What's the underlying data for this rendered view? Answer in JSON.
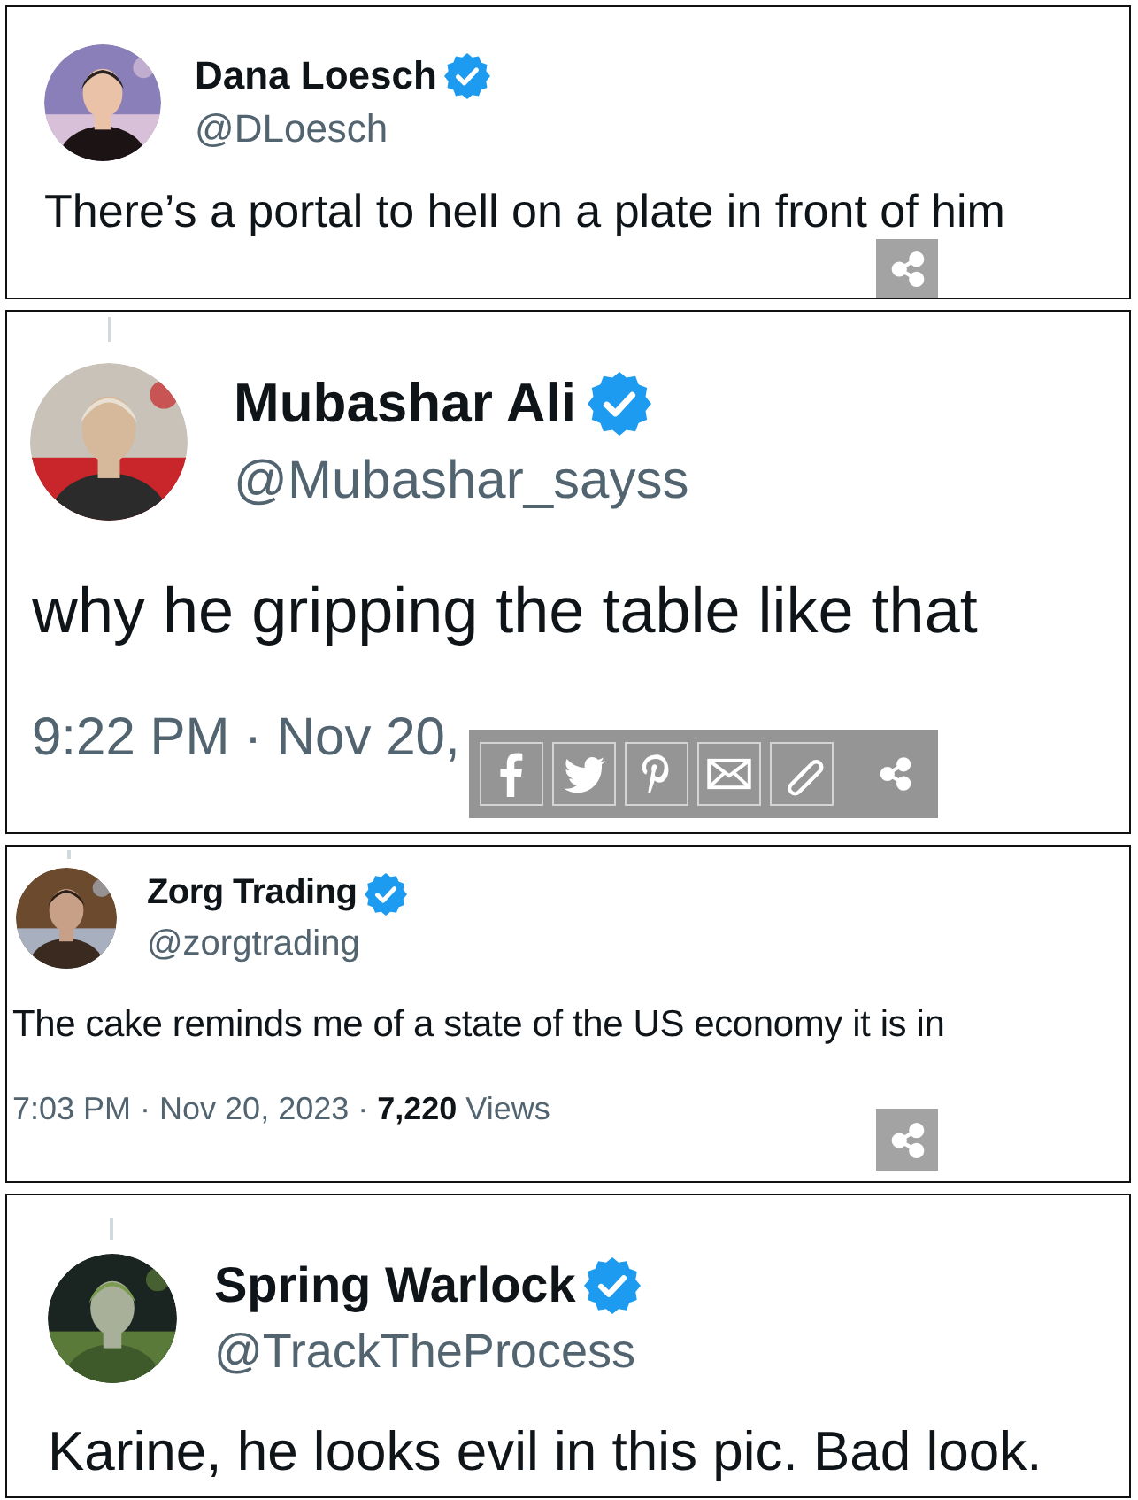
{
  "tweets": [
    {
      "name": "Dana Loesch",
      "verified": true,
      "handle": "@DLoesch",
      "thread_line": false,
      "text": "There’s a portal to hell on a plate in front of him",
      "share": {
        "kind": "button"
      }
    },
    {
      "name": "Mubashar Ali",
      "verified": true,
      "handle": "@Mubashar_sayss",
      "thread_line": true,
      "text": "why he gripping the table like that",
      "footer": "9:22 PM · Nov 20,",
      "share": {
        "kind": "toolbar"
      }
    },
    {
      "name": "Zorg Trading",
      "verified": true,
      "handle": "@zorgtrading",
      "thread_line": true,
      "text": "The cake reminds me of a state of the US economy it is in",
      "footer": "7:03 PM · Nov 20, 2023 · **7,220** Views",
      "share": {
        "kind": "button"
      }
    },
    {
      "name": "Spring Warlock",
      "verified": true,
      "handle": "@TrackTheProcess",
      "thread_line": true,
      "text": "Karine, he looks evil in this pic. Bad look."
    }
  ]
}
